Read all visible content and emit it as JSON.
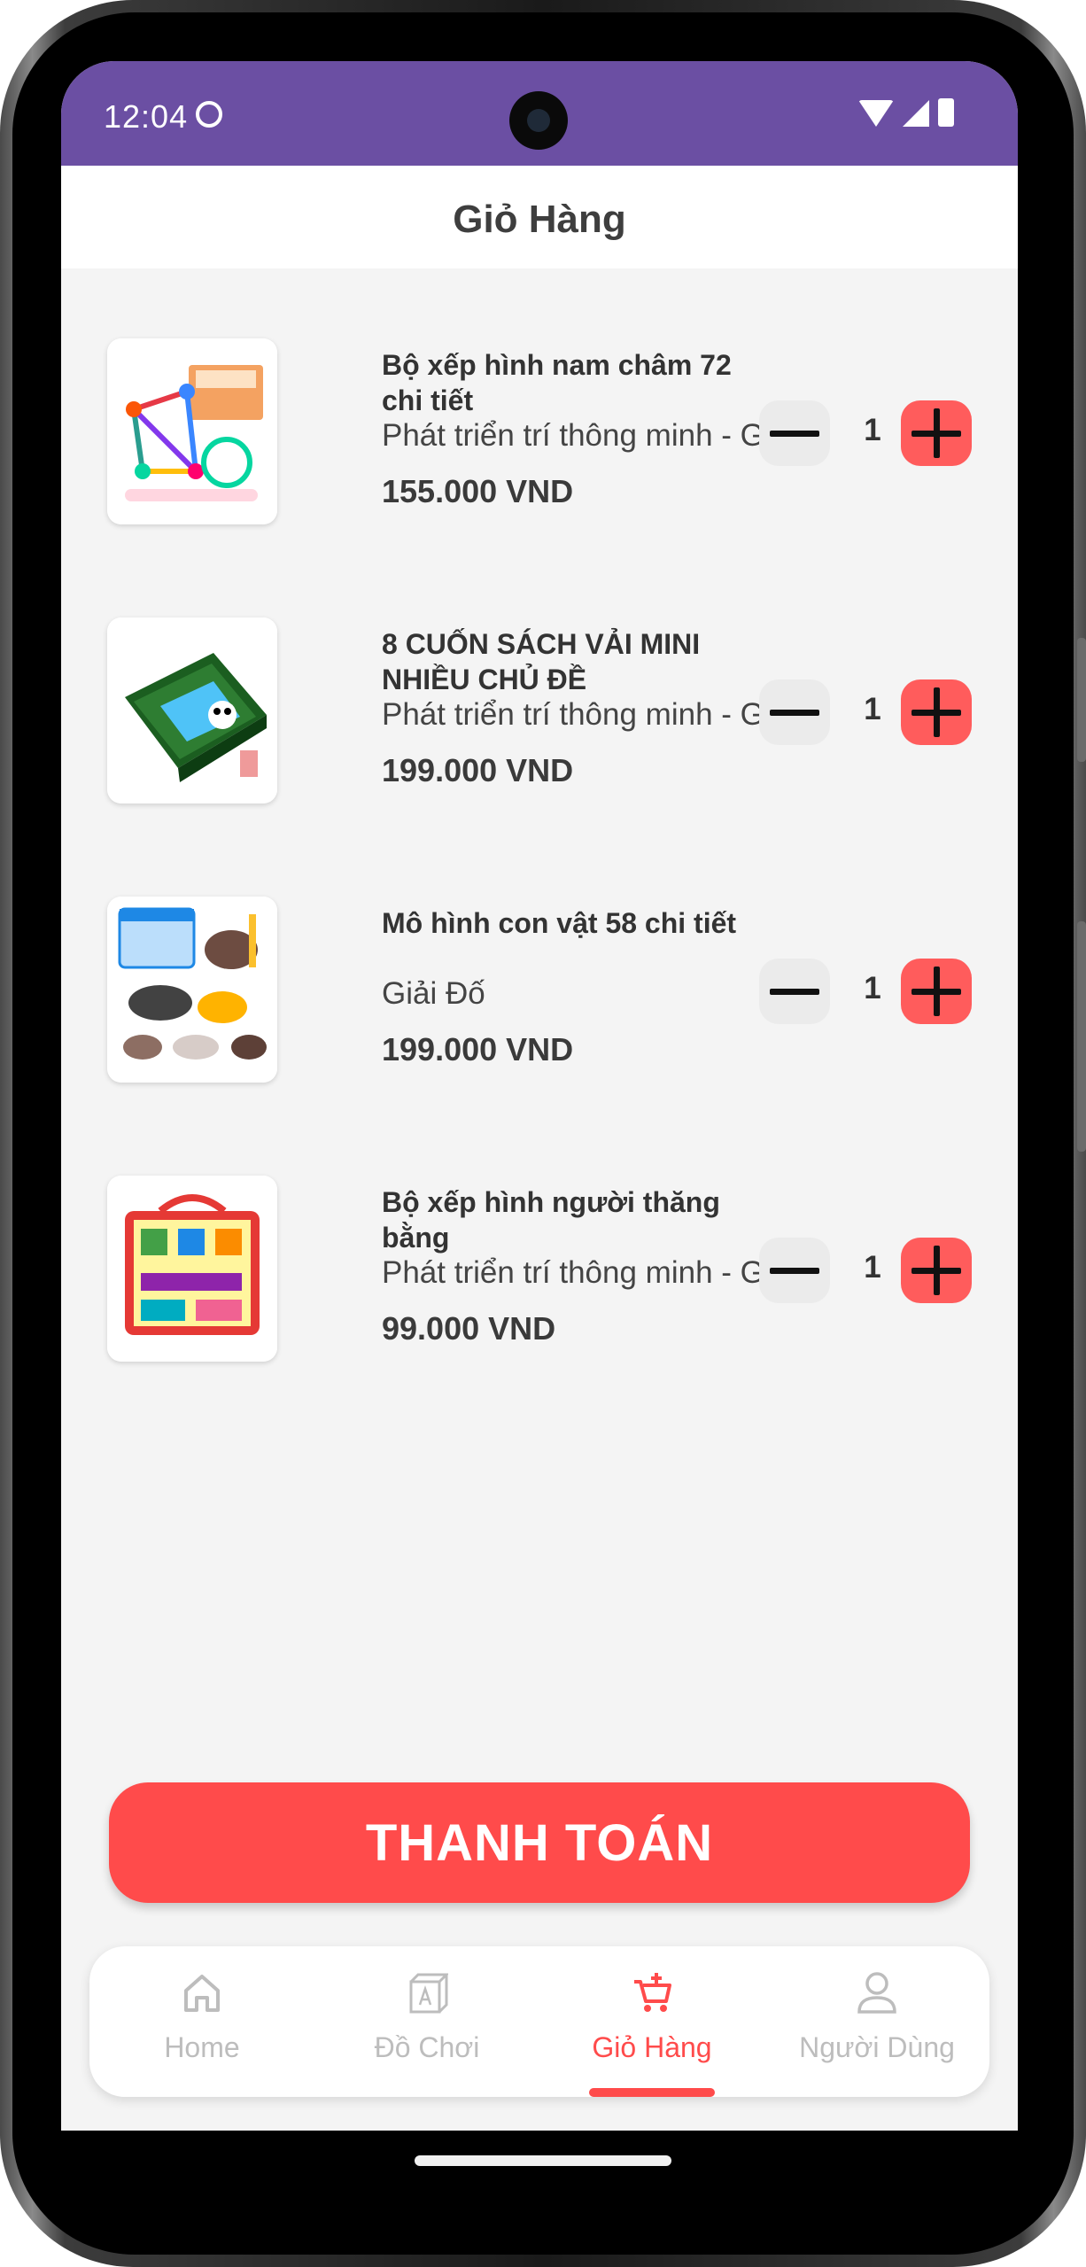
{
  "status": {
    "time": "12:04"
  },
  "header": {
    "title": "Giỏ Hàng"
  },
  "cart": {
    "items": [
      {
        "name": "Bộ xếp hình nam châm 72 chi tiết",
        "category": "Phát triển trí thông minh - Giải Đố",
        "price": "155.000 VND",
        "qty": "1"
      },
      {
        "name": "8 CUỐN SÁCH VẢI MINI NHIỀU CHỦ ĐỀ",
        "category": "Phát triển trí thông minh - Giải Đố",
        "price": "199.000 VND",
        "qty": "1"
      },
      {
        "name": "Mô hình con vật 58 chi tiết",
        "category": "Giải Đố",
        "price": "199.000 VND",
        "qty": "1"
      },
      {
        "name": "Bộ xếp hình người thăng bằng",
        "category": "Phát triển trí thông minh - Giải Đố",
        "price": "99.000 VND",
        "qty": "1"
      }
    ],
    "checkout_label": "THANH TOÁN"
  },
  "nav": {
    "items": [
      {
        "label": "Home",
        "icon": "home-icon"
      },
      {
        "label": "Đồ Chơi",
        "icon": "toy-box-icon"
      },
      {
        "label": "Giỏ Hàng",
        "icon": "cart-add-icon",
        "active": true
      },
      {
        "label": "Người Dùng",
        "icon": "user-icon"
      }
    ]
  },
  "colors": {
    "statusbar": "#6b4fa3",
    "accent": "#ff4b4b",
    "background": "#f4f4f4"
  }
}
